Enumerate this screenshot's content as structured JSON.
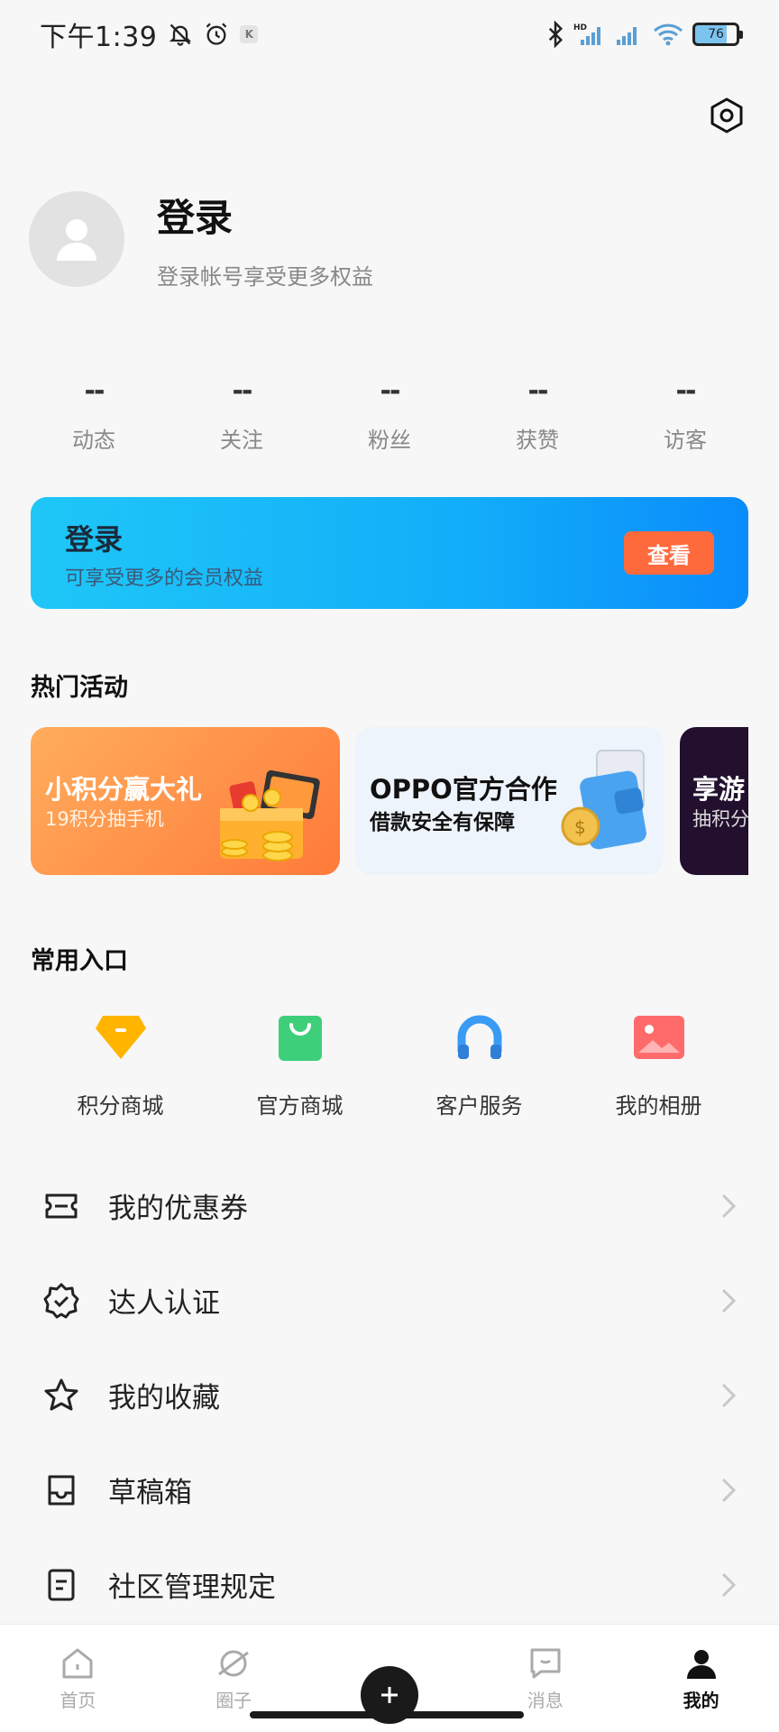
{
  "status_bar": {
    "time": "下午1:39",
    "battery": "76",
    "k_badge": "K"
  },
  "profile": {
    "title": "登录",
    "subtitle": "登录帐号享受更多权益"
  },
  "stats": [
    {
      "value": "--",
      "label": "动态"
    },
    {
      "value": "--",
      "label": "关注"
    },
    {
      "value": "--",
      "label": "粉丝"
    },
    {
      "value": "--",
      "label": "获赞"
    },
    {
      "value": "--",
      "label": "访客"
    }
  ],
  "vip_banner": {
    "title": "登录",
    "subtitle": "可享受更多的会员权益",
    "button": "查看"
  },
  "hot_activities": {
    "title": "热门活动",
    "cards": [
      {
        "title": "小积分赢大礼",
        "subtitle": "19积分抽手机"
      },
      {
        "title": "OPPO官方合作",
        "subtitle": "借款安全有保障"
      },
      {
        "title": "享游",
        "subtitle": "抽积分"
      }
    ]
  },
  "shortcuts": {
    "title": "常用入口",
    "items": [
      {
        "label": "积分商城",
        "icon": "diamond-icon",
        "color": "#ffb400"
      },
      {
        "label": "官方商城",
        "icon": "shopping-bag-icon",
        "color": "#3ecf7a"
      },
      {
        "label": "客户服务",
        "icon": "headphones-icon",
        "color": "#3a9bf5"
      },
      {
        "label": "我的相册",
        "icon": "photo-icon",
        "color": "#ff6b6b"
      }
    ]
  },
  "menu": [
    {
      "label": "我的优惠券",
      "icon": "coupon-icon"
    },
    {
      "label": "达人认证",
      "icon": "verified-badge-icon"
    },
    {
      "label": "我的收藏",
      "icon": "star-icon"
    },
    {
      "label": "草稿箱",
      "icon": "drafts-tray-icon"
    },
    {
      "label": "社区管理规定",
      "icon": "document-icon"
    }
  ],
  "tabbar": {
    "items": [
      {
        "label": "首页",
        "icon": "home-icon"
      },
      {
        "label": "圈子",
        "icon": "planet-icon"
      },
      {
        "label": "",
        "icon": "plus-icon"
      },
      {
        "label": "消息",
        "icon": "message-icon"
      },
      {
        "label": "我的",
        "icon": "person-icon"
      }
    ],
    "active_index": 4
  }
}
